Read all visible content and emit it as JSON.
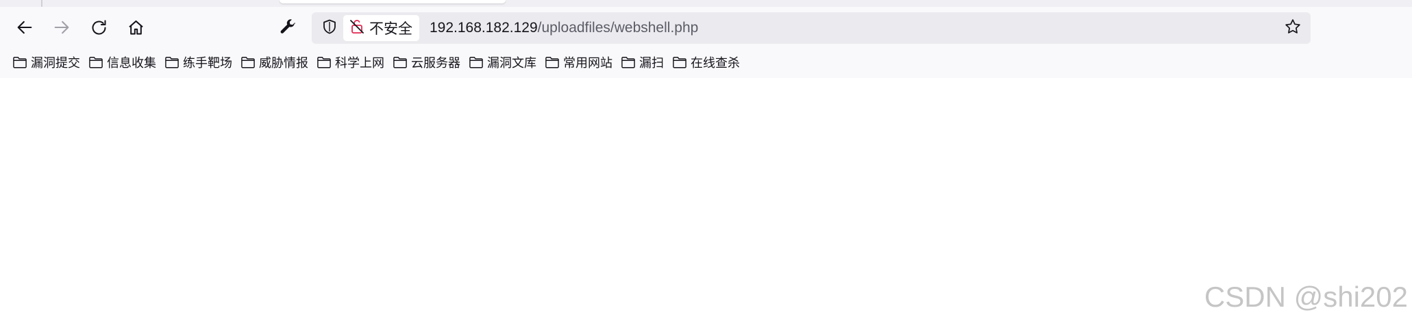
{
  "urlbar": {
    "security_label": "不安全",
    "host": "192.168.182.129",
    "path": "/uploadfiles/webshell.php"
  },
  "icons": {
    "back": "arrow-left-icon",
    "forward": "arrow-right-icon",
    "reload": "reload-icon",
    "home": "home-icon",
    "tools": "wrench-icon",
    "tracking": "shield-icon",
    "insecure": "insecure-lock-icon",
    "bookmark_star": "star-icon",
    "folder": "folder-icon"
  },
  "colors": {
    "insecure_lock": "#e22850",
    "chrome_bg": "#f9f9fb",
    "urlbar_bg": "#ebebef"
  },
  "bookmarks": [
    {
      "label": "漏洞提交"
    },
    {
      "label": "信息收集"
    },
    {
      "label": "练手靶场"
    },
    {
      "label": "威胁情报"
    },
    {
      "label": "科学上网"
    },
    {
      "label": "云服务器"
    },
    {
      "label": "漏洞文库"
    },
    {
      "label": "常用网站"
    },
    {
      "label": "漏扫"
    },
    {
      "label": "在线查杀"
    }
  ],
  "watermark": "CSDN @shi202"
}
